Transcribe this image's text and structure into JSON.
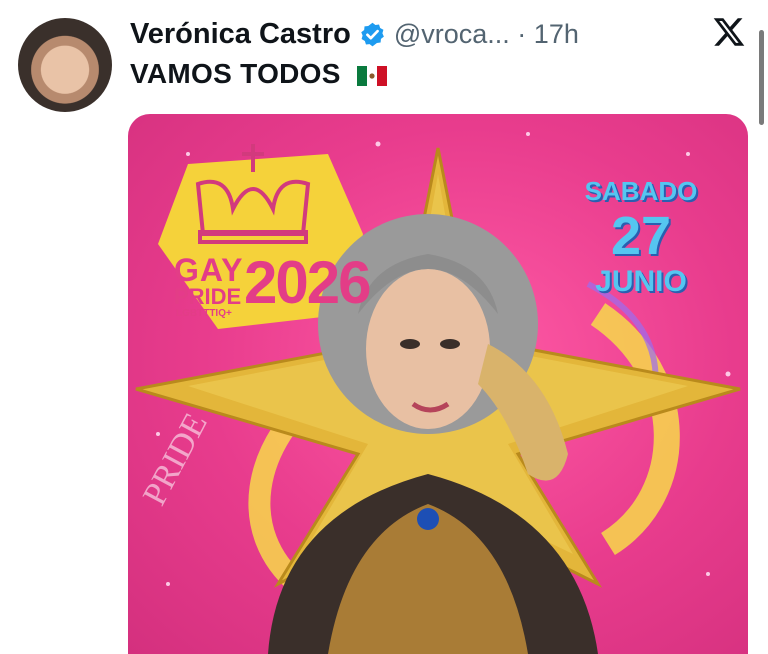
{
  "post": {
    "author_name": "Verónica Castro",
    "handle": "@vroca...",
    "separator": "·",
    "time": "17h",
    "text": "VAMOS TODOS"
  },
  "icons": {
    "verified": "verified-badge-icon",
    "platform": "x-logo-icon",
    "flag": "mexico-flag-icon"
  },
  "poster": {
    "logo_gay": "GAY",
    "logo_pride": "PRIDE",
    "logo_year": "2026",
    "logo_subtitle": "LGBTTTIQ+",
    "date_day": "SABADO",
    "date_number": "27",
    "date_month": "JUNIO",
    "watermark": "PRIDE"
  },
  "colors": {
    "verified_blue": "#1d9bf0",
    "poster_pink": "#e83c8d",
    "poster_yellow": "#f5d23a",
    "date_blue": "#55c6f0"
  }
}
